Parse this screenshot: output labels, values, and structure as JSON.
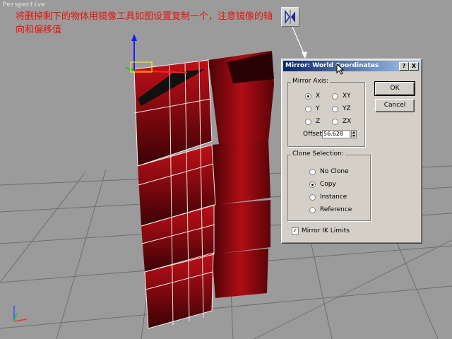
{
  "viewport": {
    "label": "Perspective"
  },
  "instruction": {
    "text": "将删掉剩下的物体用镜像工具如图设置复制一个，注意镜像的轴向和偏移值"
  },
  "toolbar": {
    "mirror_tool_icon": "mirror-tool-icon"
  },
  "dialog": {
    "title": "Mirror: World Coordinates",
    "help_btn": "?",
    "close_btn": "X",
    "mirror_axis": {
      "label": "Mirror Axis:",
      "options": [
        "X",
        "XY",
        "Y",
        "YZ",
        "Z",
        "ZX"
      ],
      "selected": "X",
      "offset_label": "Offset:",
      "offset_value": "56.628"
    },
    "clone_selection": {
      "label": "Clone Selection:",
      "options": [
        "No Clone",
        "Copy",
        "Instance",
        "Reference"
      ],
      "selected": "Copy"
    },
    "mirror_ik": {
      "label": "Mirror IK Limits",
      "checked": true
    },
    "ok_label": "OK",
    "cancel_label": "Cancel"
  },
  "colors": {
    "object": "#8b0a12",
    "accent": "#e8110a",
    "titlebar": "#0a246a"
  }
}
